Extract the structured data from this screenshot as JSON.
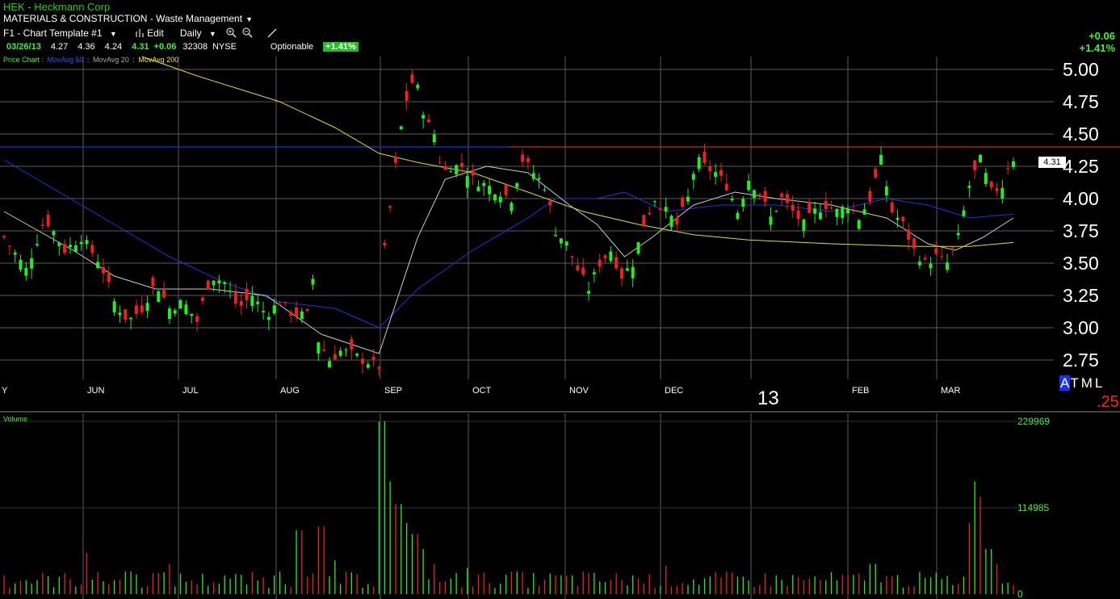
{
  "header": {
    "title": "HEK - Heckmann Corp",
    "sector": "MATERIALS & CONSTRUCTION - Waste Management",
    "sector_caret": "▼",
    "template": "F1 - Chart Template #1",
    "template_caret": "▼",
    "edit": "Edit",
    "period": "Daily",
    "period_caret": "▼"
  },
  "quote": {
    "date": "03/26/13",
    "open": "4.27",
    "high": "4.36",
    "low": "4.24",
    "last": "4.31",
    "change": "+0.06",
    "volume": "32308",
    "exchange": "NYSE",
    "optionable": "Optionable",
    "pct": "+1.41%"
  },
  "top_right": {
    "change": "+0.06",
    "pct": "+1.41%"
  },
  "legend": {
    "price": "Price Chart :",
    "ma50": "MovAvg 50",
    "ma20": "MovAvg 20",
    "ma200": "MovAvg 200",
    "sep": ":"
  },
  "colors": {
    "up": "#22ee22",
    "down": "#ee2020",
    "ma50": "#2233dd",
    "ma20": "#cccccc",
    "ma200": "#dddd33",
    "grid": "#5a5a5a",
    "resistance": "#cc2222",
    "support_line": "#2233dd"
  },
  "markers": {
    "big13": "13",
    "atml_a": "A",
    "atml_rest": "TML",
    "q25": ".25",
    "volume_title": "Volume",
    "last_box": "4.31"
  },
  "chart_data": [
    {
      "type": "candlestick",
      "title": "",
      "x_ticks": [
        "Y",
        "JUN",
        "JUL",
        "AUG",
        "SEP",
        "OCT",
        "NOV",
        "DEC",
        "13",
        "FEB",
        "MAR"
      ],
      "y_ticks": [
        "5.00",
        "4.75",
        "4.50",
        "4.25",
        "4.00",
        "3.75",
        "3.50",
        "3.25",
        "3.00",
        "2.75"
      ],
      "ylim": [
        2.6,
        5.1
      ],
      "grid": true,
      "horizontal_lines": [
        4.4
      ],
      "last_price": 4.31,
      "anchors_close": [
        [
          0,
          3.7
        ],
        [
          8,
          3.45
        ],
        [
          15,
          3.85
        ],
        [
          22,
          3.6
        ],
        [
          28,
          3.7
        ],
        [
          35,
          3.5
        ],
        [
          40,
          3.2
        ],
        [
          45,
          3.05
        ],
        [
          50,
          3.15
        ],
        [
          55,
          3.35
        ],
        [
          60,
          3.15
        ],
        [
          65,
          3.2
        ],
        [
          70,
          3.05
        ],
        [
          75,
          3.4
        ],
        [
          80,
          3.35
        ],
        [
          85,
          3.15
        ],
        [
          90,
          3.25
        ],
        [
          95,
          3.1
        ],
        [
          100,
          3.2
        ],
        [
          105,
          3.1
        ],
        [
          110,
          3.1
        ],
        [
          112,
          3.38
        ],
        [
          114,
          2.9
        ],
        [
          118,
          2.75
        ],
        [
          122,
          2.82
        ],
        [
          126,
          2.8
        ],
        [
          130,
          2.75
        ],
        [
          134,
          2.72
        ],
        [
          136,
          2.7
        ],
        [
          138,
          3.6
        ],
        [
          142,
          4.25
        ],
        [
          145,
          4.7
        ],
        [
          148,
          4.9
        ],
        [
          150,
          4.85
        ],
        [
          153,
          4.6
        ],
        [
          156,
          4.5
        ],
        [
          159,
          4.2
        ],
        [
          162,
          4.25
        ],
        [
          166,
          4.25
        ],
        [
          170,
          4.15
        ],
        [
          175,
          4.1
        ],
        [
          180,
          4.05
        ],
        [
          184,
          4.0
        ],
        [
          188,
          4.3
        ],
        [
          192,
          4.2
        ],
        [
          196,
          4.1
        ],
        [
          200,
          3.75
        ],
        [
          204,
          3.65
        ],
        [
          208,
          3.45
        ],
        [
          212,
          3.3
        ],
        [
          216,
          3.5
        ],
        [
          220,
          3.6
        ],
        [
          224,
          3.4
        ],
        [
          228,
          3.5
        ],
        [
          232,
          3.8
        ],
        [
          236,
          4.0
        ],
        [
          240,
          3.9
        ],
        [
          244,
          3.8
        ],
        [
          248,
          4.0
        ],
        [
          251,
          4.3
        ],
        [
          254,
          4.25
        ],
        [
          258,
          4.2
        ],
        [
          262,
          4.1
        ],
        [
          266,
          3.9
        ],
        [
          270,
          4.15
        ],
        [
          274,
          4.05
        ],
        [
          278,
          3.85
        ],
        [
          282,
          4.0
        ],
        [
          286,
          3.9
        ],
        [
          290,
          3.8
        ],
        [
          294,
          3.9
        ],
        [
          298,
          3.95
        ],
        [
          302,
          3.9
        ],
        [
          306,
          3.95
        ],
        [
          310,
          3.85
        ],
        [
          314,
          4.0
        ],
        [
          318,
          4.3
        ],
        [
          322,
          3.9
        ],
        [
          326,
          3.8
        ],
        [
          330,
          3.6
        ],
        [
          334,
          3.5
        ],
        [
          338,
          3.55
        ],
        [
          342,
          3.5
        ],
        [
          346,
          3.7
        ],
        [
          350,
          4.1
        ],
        [
          354,
          4.3
        ],
        [
          358,
          4.05
        ],
        [
          362,
          4.1
        ],
        [
          364,
          4.25
        ],
        [
          366,
          4.31
        ]
      ],
      "ma_lines": [
        {
          "name": "MovAvg 50",
          "points": [
            [
              0,
              4.3
            ],
            [
              20,
              4.05
            ],
            [
              40,
              3.8
            ],
            [
              60,
              3.55
            ],
            [
              80,
              3.35
            ],
            [
              100,
              3.2
            ],
            [
              120,
              3.15
            ],
            [
              136,
              3.0
            ],
            [
              150,
              3.3
            ],
            [
              170,
              3.6
            ],
            [
              190,
              3.85
            ],
            [
              200,
              4.0
            ],
            [
              215,
              4.0
            ],
            [
              225,
              4.05
            ],
            [
              240,
              3.9
            ],
            [
              260,
              3.95
            ],
            [
              280,
              3.95
            ],
            [
              300,
              3.9
            ],
            [
              320,
              4.0
            ],
            [
              335,
              3.95
            ],
            [
              350,
              3.85
            ],
            [
              366,
              3.88
            ]
          ]
        },
        {
          "name": "MovAvg 20",
          "points": [
            [
              0,
              3.9
            ],
            [
              25,
              3.6
            ],
            [
              40,
              3.4
            ],
            [
              55,
              3.3
            ],
            [
              75,
              3.3
            ],
            [
              95,
              3.25
            ],
            [
              115,
              2.95
            ],
            [
              136,
              2.8
            ],
            [
              150,
              3.7
            ],
            [
              160,
              4.15
            ],
            [
              175,
              4.25
            ],
            [
              190,
              4.2
            ],
            [
              205,
              3.95
            ],
            [
              215,
              3.8
            ],
            [
              225,
              3.55
            ],
            [
              235,
              3.7
            ],
            [
              250,
              3.95
            ],
            [
              265,
              4.05
            ],
            [
              280,
              4.0
            ],
            [
              300,
              3.95
            ],
            [
              320,
              3.85
            ],
            [
              335,
              3.65
            ],
            [
              345,
              3.6
            ],
            [
              355,
              3.7
            ],
            [
              366,
              3.85
            ]
          ]
        },
        {
          "name": "MovAvg 200",
          "points": [
            [
              50,
              5.1
            ],
            [
              70,
              4.95
            ],
            [
              100,
              4.75
            ],
            [
              120,
              4.55
            ],
            [
              136,
              4.35
            ],
            [
              150,
              4.28
            ],
            [
              170,
              4.2
            ],
            [
              190,
              4.05
            ],
            [
              210,
              3.9
            ],
            [
              230,
              3.8
            ],
            [
              250,
              3.72
            ],
            [
              270,
              3.68
            ],
            [
              300,
              3.65
            ],
            [
              330,
              3.63
            ],
            [
              350,
              3.63
            ],
            [
              366,
              3.66
            ]
          ]
        }
      ]
    },
    {
      "type": "bar",
      "title": "Volume",
      "y_ticks": [
        "229969",
        "114985",
        "0"
      ],
      "ylim": [
        0,
        229969
      ],
      "spikes": [
        [
          0,
          25000
        ],
        [
          30,
          55000
        ],
        [
          45,
          30000
        ],
        [
          55,
          28000
        ],
        [
          60,
          40000
        ],
        [
          80,
          25000
        ],
        [
          100,
          30000
        ],
        [
          107,
          85000
        ],
        [
          115,
          90000
        ],
        [
          120,
          45000
        ],
        [
          137,
          229969
        ],
        [
          138,
          200000
        ],
        [
          140,
          150000
        ],
        [
          143,
          120000
        ],
        [
          146,
          95000
        ],
        [
          149,
          80000
        ],
        [
          152,
          60000
        ],
        [
          156,
          40000
        ],
        [
          168,
          35000
        ],
        [
          185,
          30000
        ],
        [
          200,
          25000
        ],
        [
          210,
          30000
        ],
        [
          228,
          25000
        ],
        [
          240,
          38000
        ],
        [
          262,
          30000
        ],
        [
          280,
          25000
        ],
        [
          315,
          40000
        ],
        [
          350,
          95000
        ],
        [
          352,
          150000
        ],
        [
          354,
          130000
        ],
        [
          357,
          60000
        ],
        [
          360,
          40000
        ]
      ]
    }
  ]
}
